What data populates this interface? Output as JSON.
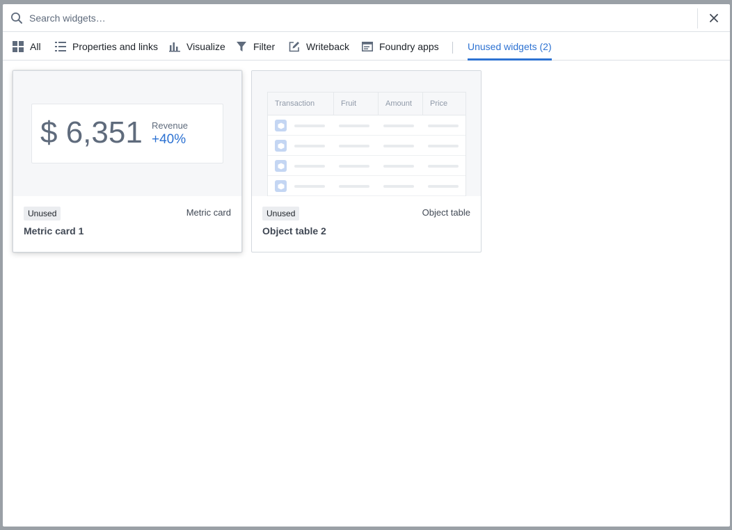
{
  "search": {
    "placeholder": "Search widgets…"
  },
  "tabs": [
    {
      "label": "All",
      "icon": "grid-icon"
    },
    {
      "label": "Properties and links",
      "icon": "list-icon"
    },
    {
      "label": "Visualize",
      "icon": "bar-chart-icon"
    },
    {
      "label": "Filter",
      "icon": "filter-icon"
    },
    {
      "label": "Writeback",
      "icon": "edit-icon"
    },
    {
      "label": "Foundry apps",
      "icon": "application-icon"
    },
    {
      "label": "Unused widgets (2)",
      "active": true
    }
  ],
  "cards": [
    {
      "tag": "Unused",
      "type": "Metric card",
      "title": "Metric card 1",
      "preview": {
        "value": "$ 6,351",
        "label": "Revenue",
        "change": "+40%"
      }
    },
    {
      "tag": "Unused",
      "type": "Object table",
      "title": "Object table 2",
      "preview": {
        "columns": [
          "Transaction",
          "Fruit",
          "Amount",
          "Price"
        ],
        "rows": 4
      }
    }
  ],
  "colors": {
    "accent": "#2d72d2",
    "cube": "#c4d6f3",
    "text": "#404854",
    "muted": "#5f6b7c"
  }
}
